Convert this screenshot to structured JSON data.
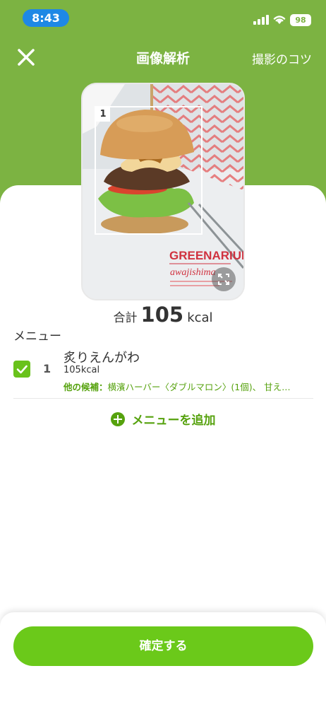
{
  "status_bar": {
    "time": "8:43",
    "battery": "98"
  },
  "header": {
    "title": "画像解析",
    "tips": "撮影のコツ"
  },
  "photo": {
    "detection_number": "1",
    "sign_text_1": "GREENARIUM",
    "sign_text_2": "awajishima"
  },
  "total": {
    "label": "合計",
    "value": "105",
    "unit": "kcal"
  },
  "menu_section": {
    "title": "メニュー"
  },
  "items": [
    {
      "number": "1",
      "name": "炙りえんがわ",
      "kcal": "105kcal",
      "alt_label": "他の候補：",
      "alt_text": "横濱ハーバー〈ダブルマロン〉(1個)、 甘え…",
      "checked": true
    }
  ],
  "add_menu": {
    "label": "メニューを追加"
  },
  "confirm": {
    "label": "確定する"
  },
  "colors": {
    "header_green": "#7cb342",
    "accent_green": "#6bc91a",
    "link_green": "#56a20e"
  }
}
